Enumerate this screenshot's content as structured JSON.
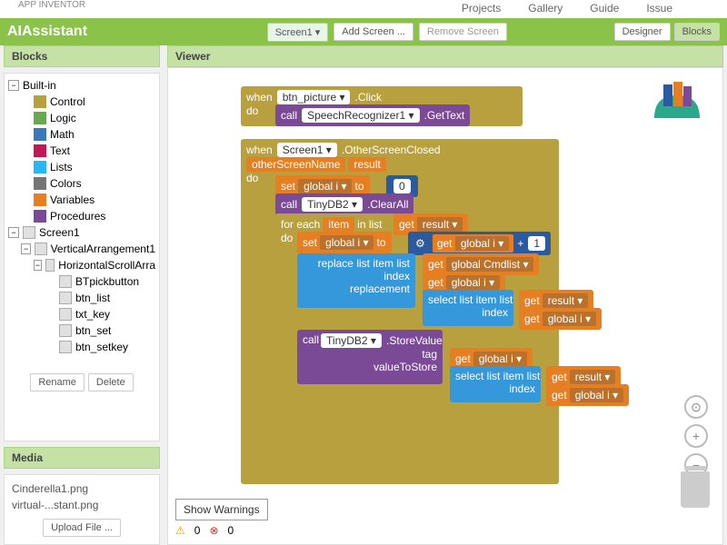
{
  "topNav": {
    "projects": "Projects",
    "gallery": "Gallery",
    "guide": "Guide",
    "issue": "Issue"
  },
  "logo": "APP INVENTOR",
  "header": {
    "title": "AIAssistant",
    "screenDropdown": "Screen1 ▾",
    "addScreen": "Add Screen ...",
    "removeScreen": "Remove Screen",
    "designer": "Designer",
    "blocks": "Blocks"
  },
  "panels": {
    "blocks": "Blocks",
    "viewer": "Viewer",
    "media": "Media"
  },
  "builtin": {
    "label": "Built-in",
    "control": "Control",
    "logic": "Logic",
    "math": "Math",
    "text": "Text",
    "lists": "Lists",
    "colors": "Colors",
    "variables": "Variables",
    "procedures": "Procedures"
  },
  "colors": {
    "control": "#b8a03e",
    "logic": "#6aa84f",
    "math": "#3b78b8",
    "text": "#c2185b",
    "lists": "#29b6f6",
    "colors": "#757575",
    "variables": "#e67e22",
    "procedures": "#7b4a96"
  },
  "comps": {
    "screen1": "Screen1",
    "va": "VerticalArrangement1",
    "hsa": "HorizontalScrollArra",
    "bt": "BTpickbutton",
    "btnlist": "btn_list",
    "txtkey": "txt_key",
    "btnset": "btn_set",
    "btnsetkey": "btn_setkey"
  },
  "actions": {
    "rename": "Rename",
    "delete": "Delete",
    "upload": "Upload File ..."
  },
  "media": {
    "f1": "Cinderella1.png",
    "f2": "virtual-...stant.png"
  },
  "warnings": {
    "warn": "0",
    "err": "0",
    "show": "Show Warnings"
  },
  "b": {
    "when": "when",
    "do": "do",
    "call": "call",
    "click": ".Click",
    "gettext": ".GetText",
    "osc": ".OtherScreenClosed",
    "osn": "otherScreenName",
    "result": "result",
    "set": "set",
    "to": "to",
    "clearall": ".ClearAll",
    "foreach": "for each",
    "item": "item",
    "inlist": "in list",
    "get": "get",
    "replace": "replace list item  list",
    "index": "index",
    "replacement": "replacement",
    "select": "select list item  list",
    "storeval": ".StoreValue",
    "tag": "tag",
    "vts": "valueToStore",
    "btnpic": "btn_picture ▾",
    "screen1": "Screen1 ▾",
    "sr1": "SpeechRecognizer1 ▾",
    "tinydb2": "TinyDB2 ▾",
    "globali": "global i ▾",
    "globalcmd": "global Cmdlist ▾",
    "resultdd": "result ▾",
    "zero": "0",
    "one": "1",
    "plus": "+"
  }
}
